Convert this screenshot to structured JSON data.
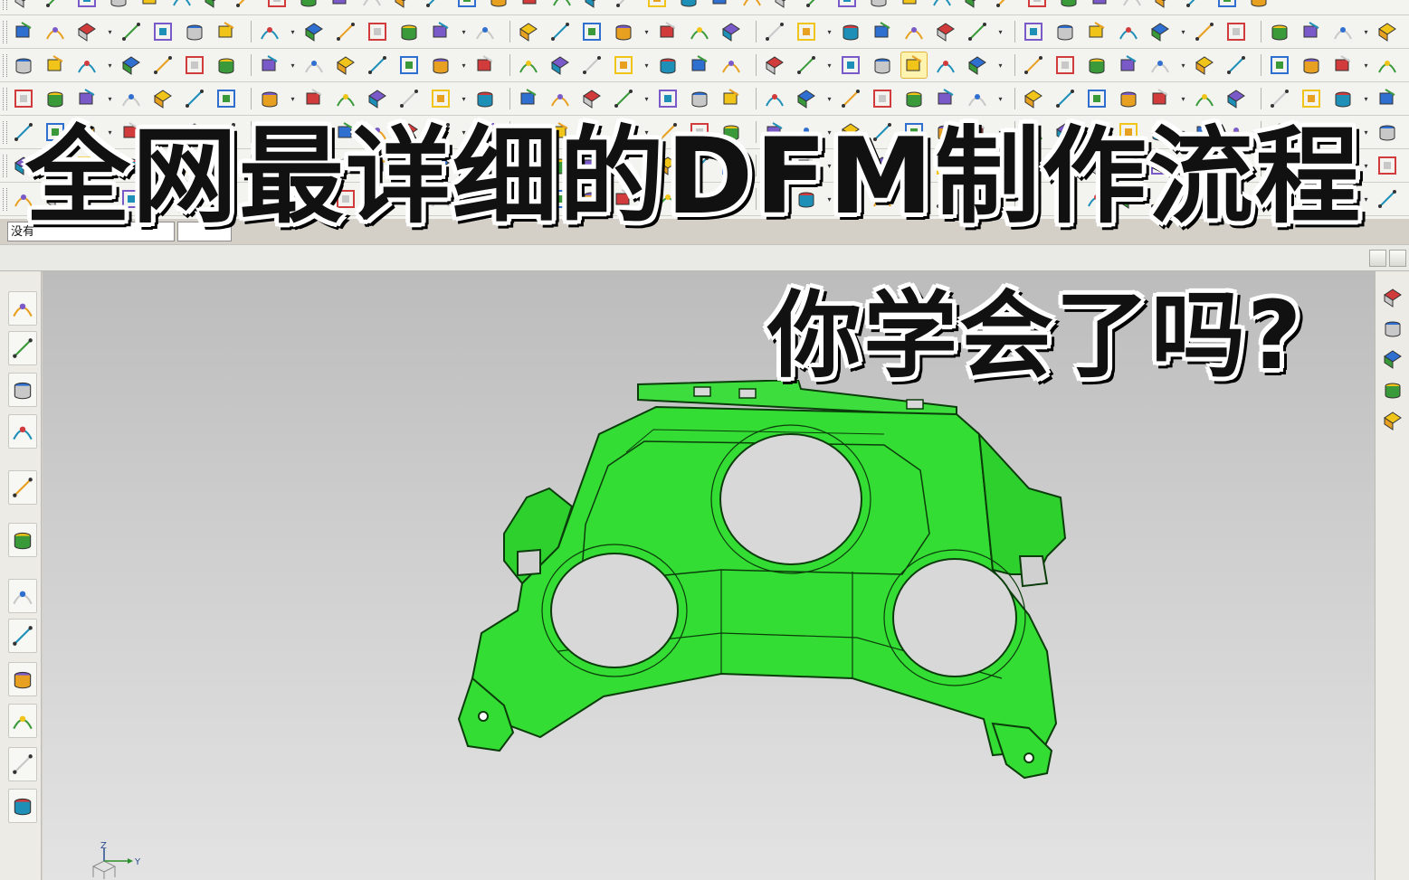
{
  "overlay": {
    "title": "全网最详细的DFM制作流程",
    "subtitle": "你学会了吗?"
  },
  "toolbar": {
    "layer_select_value": "没有",
    "filter_select_value": "",
    "row1_icons": [
      "sketch-icon",
      "layers-icon",
      "table-icon",
      "pencil-icon",
      "extrude-icon",
      "hammer-icon",
      "blend-icon",
      "text-box-icon",
      "line-icon",
      "eraser-icon",
      "graph-icon",
      "cylinder-icon",
      "spring-icon",
      "coin-icon",
      "screw-icon",
      "move-icon",
      "cube-edit-icon",
      "box-icon",
      "copy-icon",
      "block-icon",
      "assembly-icon",
      "sheet-icon",
      "measure-icon"
    ],
    "row2_icons": [
      "check-icon",
      "sheet-stack-icon",
      "rack-icon",
      "axis-icon",
      "rectangle-icon",
      "chamfer-icon",
      "sweep-icon",
      "shell-icon",
      "pattern-icon",
      "offset-icon",
      "trim-icon",
      "sew-icon",
      "point-icon",
      "arc-icon",
      "text-a-icon",
      "spline-icon",
      "curve-icon",
      "curve2-icon",
      "hole-icon",
      "loft-icon",
      "face-icon",
      "dim-icon",
      "ruler-icon",
      "line-dd-icon",
      "analysis-icon",
      "yellow-cube-icon",
      "blue-cube-icon"
    ],
    "row3_icons": [
      "line-icon",
      "arc-icon",
      "spline-icon",
      "helix-icon",
      "curve-icon",
      "curve2-icon",
      "curve3-icon",
      "text-a-icon",
      "surface-icon",
      "draft-icon",
      "cylinder-icon",
      "ruled-icon",
      "grid-face-icon",
      "bridge-icon",
      "offset-face-icon",
      "flange-icon",
      "patch-icon",
      "mesh-icon",
      "mesh2-icon",
      "mesh3-icon",
      "info-icon",
      "triangle-icon"
    ],
    "row4_icons": [
      "gears-icon",
      "gears2-icon",
      "doc-icon",
      "curve-icon",
      "analysis-icon",
      "dim-icon",
      "ruler-icon",
      "section-icon",
      "no-icon"
    ],
    "row5_icons": [
      "gears-icon",
      "grid-icon",
      "wave-icon",
      "spring-icon",
      "cube-icon",
      "orange-block-icon"
    ],
    "row6_icons": [
      "ruler-icon",
      "info-icon",
      "orange-block-icon"
    ]
  },
  "left_bar": {
    "icons": [
      "assembly-navigator-icon",
      "constraint-navigator-icon",
      "part-navigator-icon",
      "reuse-library-icon",
      "help-info-icon",
      "web-browser-icon",
      "history-icon",
      "system-materials-icon",
      "process-studio-icon",
      "manufacturing-wizard-icon",
      "roles-icon",
      "visualization-icon"
    ]
  },
  "right_bar": {
    "icons": [
      "view-cube-icon",
      "shading-icon",
      "list-icon",
      "assembly-icon",
      "cylinder-icon"
    ]
  },
  "viewport": {
    "part_color": "#33dd33",
    "part_edge_color": "#0b3d0b",
    "triad": {
      "z_label": "Z",
      "y_label": "Y"
    }
  },
  "colors": {
    "toolbar_bg": "#f3f3f0",
    "viewport_top": "#bcbcbc",
    "viewport_bottom": "#e3e3e3",
    "banner_text": "#111111",
    "banner_outline": "#ffffff"
  }
}
